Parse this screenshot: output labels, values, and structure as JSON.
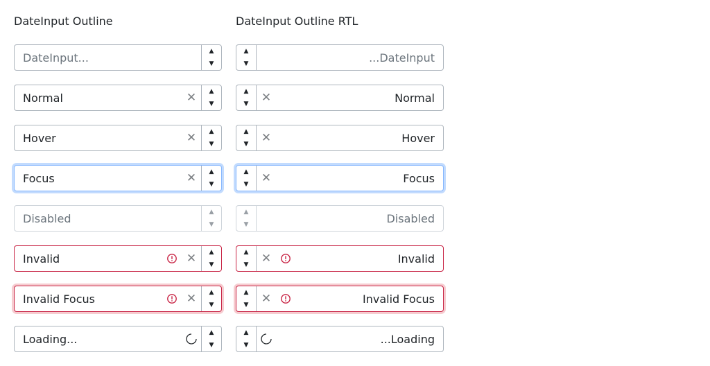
{
  "columns": {
    "ltr": {
      "title": "DateInput Outline"
    },
    "rtl": {
      "title": "DateInput Outline RTL"
    }
  },
  "fields": {
    "placeholder": {
      "placeholder_ltr": "DateInput...",
      "placeholder_rtl": "DateInput..."
    },
    "normal": {
      "value": "Normal"
    },
    "hover": {
      "value": "Hover"
    },
    "focus": {
      "value": "Focus"
    },
    "disabled": {
      "placeholder": "Disabled"
    },
    "invalid": {
      "value": "Invalid"
    },
    "invalid_focus": {
      "value": "Invalid Focus"
    },
    "loading": {
      "value_ltr": "Loading...",
      "value_rtl": "Loading..."
    }
  },
  "glyphs": {
    "clear": "✕",
    "up": "▲",
    "down": "▼"
  },
  "colors": {
    "border": "#adb5bd",
    "focus_ring": "#86b7fe",
    "invalid": "#c82344",
    "placeholder": "#6c757d"
  }
}
